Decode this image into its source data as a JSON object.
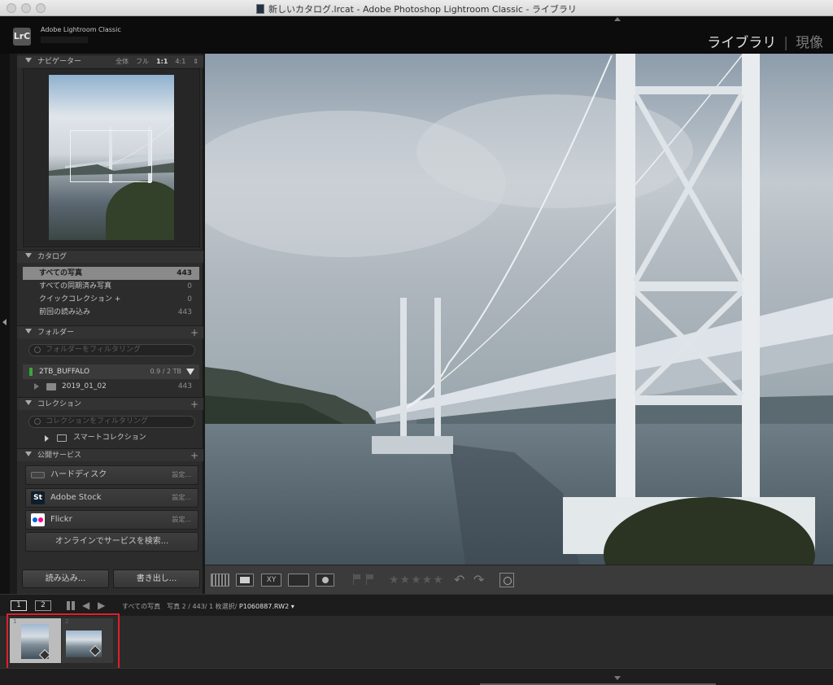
{
  "window": {
    "title": "新しいカタログ.lrcat - Adobe Photoshop Lightroom Classic - ライブラリ"
  },
  "identity": {
    "logo": "LrC",
    "app_name": "Adobe Lightroom Classic"
  },
  "modules": [
    {
      "label": "ライブラリ",
      "active": true
    },
    {
      "label": "現像",
      "active": false
    }
  ],
  "navigator": {
    "title": "ナビゲーター",
    "options": [
      "全体",
      "フル",
      "1:1",
      "4:1"
    ],
    "selected_option": "1:1"
  },
  "catalog": {
    "title": "カタログ",
    "items": [
      {
        "label": "すべての写真",
        "count": "443",
        "selected": true
      },
      {
        "label": "すべての同期済み写真",
        "count": "0"
      },
      {
        "label": "クイックコレクション +",
        "count": "0"
      },
      {
        "label": "前回の読み込み",
        "count": "443"
      }
    ]
  },
  "folders": {
    "title": "フォルダー",
    "filter_placeholder": "フォルダーをフィルタリング",
    "volume": {
      "name": "2TB_BUFFALO",
      "size": "0.9 / 2 TB"
    },
    "folder": {
      "name": "2019_01_02",
      "count": "443"
    }
  },
  "collections": {
    "title": "コレクション",
    "filter_placeholder": "コレクションをフィルタリング",
    "smart_collection": "スマートコレクション"
  },
  "publish": {
    "title": "公開サービス",
    "services": [
      {
        "label": "ハードディスク",
        "setting": "設定..."
      },
      {
        "label": "Adobe Stock",
        "setting": "設定...",
        "icon_text": "St"
      },
      {
        "label": "Flickr",
        "setting": "設定..."
      }
    ],
    "search_label": "オンラインでサービスを検索..."
  },
  "buttons": {
    "import": "読み込み...",
    "export": "書き出し..."
  },
  "toolbar": {
    "stars": "★★★★★",
    "compare_label": "XY"
  },
  "filmstrip_bar": {
    "screen1": "1",
    "screen2": "2",
    "source": "すべての写真",
    "info": "写真 2 / 443/ 1 枚選択/",
    "filename": "P1060887.RW2 ▾"
  },
  "filmstrip": {
    "cells": [
      {
        "num": "1"
      },
      {
        "num": "2"
      }
    ]
  },
  "colors": {
    "selection_frame": "#e0202a",
    "volume_led": "#3aa63a"
  }
}
